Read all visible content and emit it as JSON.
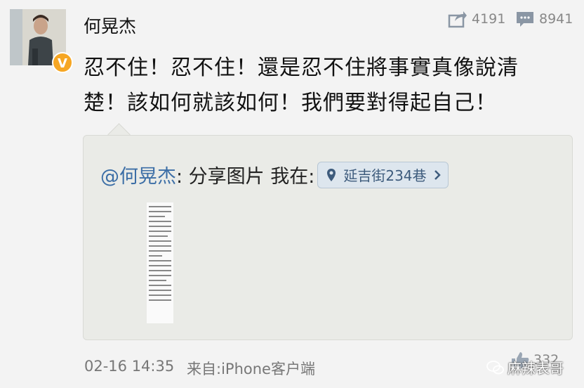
{
  "user": {
    "name": "何晃杰",
    "verified_badge": "V"
  },
  "stats": {
    "reposts": "4191",
    "comments": "8941"
  },
  "post": {
    "line1": "忍不住！忍不住！還是忍不住將事實真像說清",
    "line2": "楚！該如何就該如何！我們要對得起自己！"
  },
  "repost": {
    "mention": "@何晃杰",
    "text": ": 分享图片 我在:",
    "location": "延吉街234巷"
  },
  "footer": {
    "time": "02-16 14:35",
    "source": "来自:iPhone客户端",
    "likes": "332"
  },
  "watermark": "麻辣表哥"
}
